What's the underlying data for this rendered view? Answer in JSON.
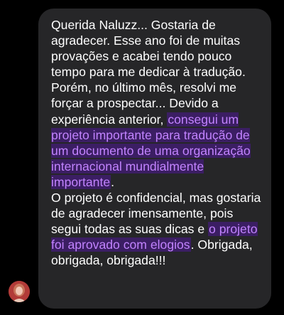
{
  "message": {
    "paragraph1": {
      "text_before": "Querida Naluzz... Gostaria de agradecer. Esse ano foi de muitas provações e acabei tendo pouco tempo para me dedicar à tradução. Porém, no último mês, resolvi me forçar a prospectar... Devido a experiência anterior, ",
      "highlight": "consegui um projeto importante para tradução de um documento de uma organização internacional mundialmente importante",
      "text_after": "."
    },
    "paragraph2": {
      "text_before": "O projeto é confidencial, mas gostaria de agradecer imensamente, pois segui todas as suas dicas e ",
      "highlight": "o projeto foi aprovado com elogios",
      "text_after": ". Obrigada, obrigada, obrigada!!!"
    }
  },
  "colors": {
    "background": "#000000",
    "bubble": "#262628",
    "text": "#ffffff",
    "highlight_text": "#c283ff",
    "highlight_bg": "#3b1e63"
  },
  "icons": {
    "avatar": "sender-avatar-photo"
  }
}
